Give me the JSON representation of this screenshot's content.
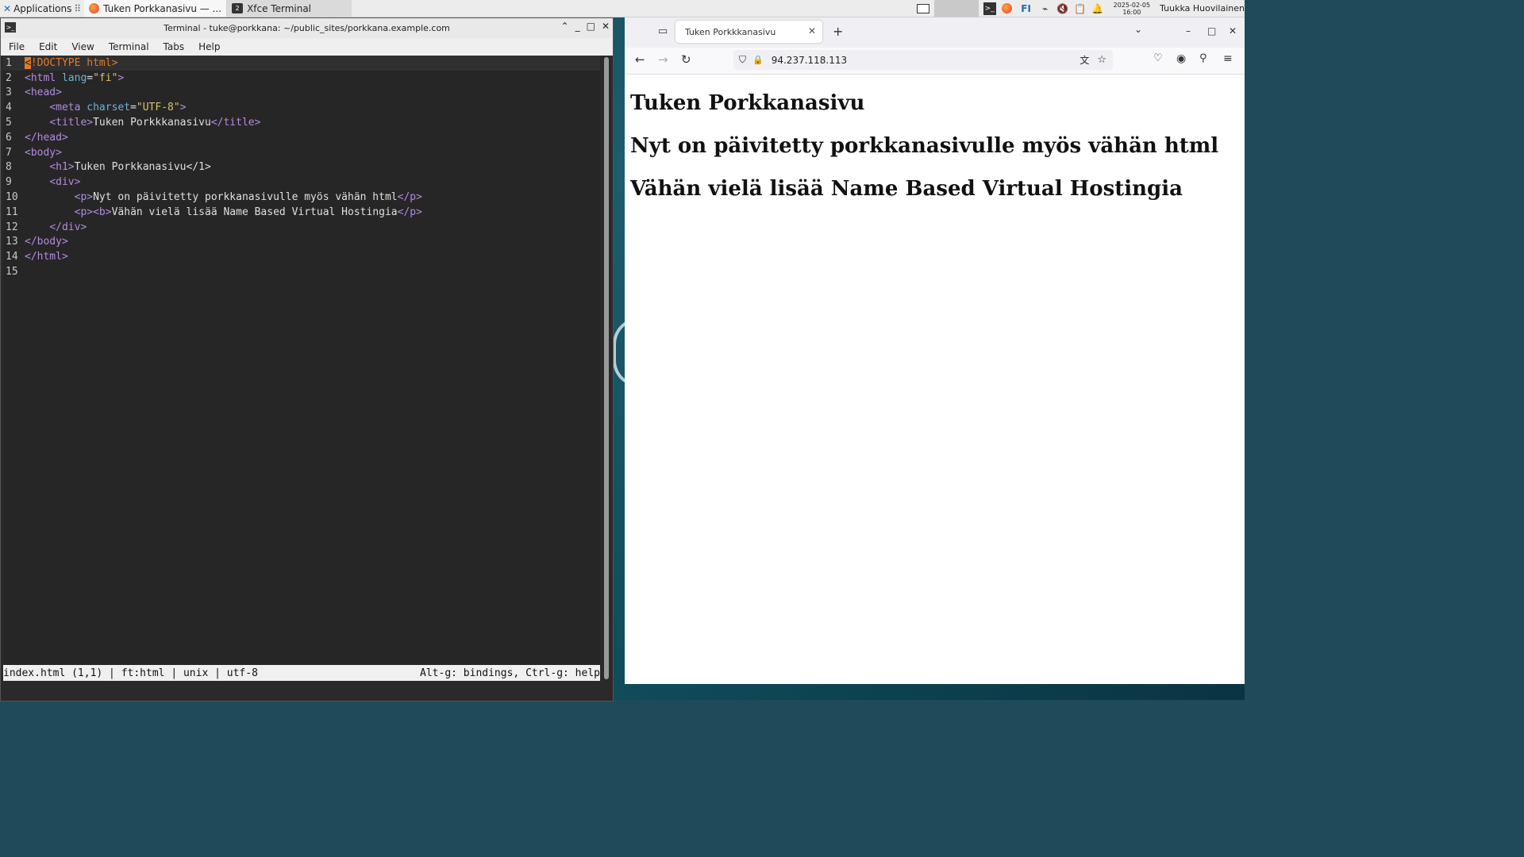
{
  "panel": {
    "apps_label": "Applications",
    "task_browser": "Tuken Porkkanasivu — ...",
    "task_terminal": "Xfce Terminal",
    "task_terminal_badge": "2",
    "keyboard_layout": "FI",
    "date": "2025-02-05",
    "time": "16:00",
    "user": "Tuukka Huovilainen"
  },
  "terminal": {
    "title": "Terminal - tuke@porkkana: ~/public_sites/porkkana.example.com",
    "menu": [
      "File",
      "Edit",
      "View",
      "Terminal",
      "Tabs",
      "Help"
    ],
    "status_left": "index.html (1,1) | ft:html | unix | utf-8",
    "status_right": "Alt-g: bindings, Ctrl-g: help",
    "lines": [
      {
        "n": "1",
        "code": "<!DOCTYPE html>"
      },
      {
        "n": "2",
        "code": "<html lang=\"fi\">"
      },
      {
        "n": "3",
        "code": "<head>"
      },
      {
        "n": "4",
        "code": "    <meta charset=\"UTF-8\">"
      },
      {
        "n": "5",
        "code": "    <title>Tuken Porkkkanasivu</title>"
      },
      {
        "n": "6",
        "code": "</head>"
      },
      {
        "n": "7",
        "code": "<body>"
      },
      {
        "n": "8",
        "code": "    <h1>Tuken Porkkanasivu</1>"
      },
      {
        "n": "9",
        "code": "    <div>"
      },
      {
        "n": "10",
        "code": "        <p>Nyt on päivitetty porkkanasivulle myös vähän html</p>"
      },
      {
        "n": "11",
        "code": "        <p><b>Vähän vielä lisää Name Based Virtual Hostingia</p>"
      },
      {
        "n": "12",
        "code": "    </div>"
      },
      {
        "n": "13",
        "code": "</body>"
      },
      {
        "n": "14",
        "code": "</html>"
      },
      {
        "n": "15",
        "code": ""
      }
    ]
  },
  "browser": {
    "tab_title": "Tuken Porkkkanasivu",
    "url": "94.237.118.113",
    "page": {
      "h1": "Tuken Porkkanasivu",
      "p1": "Nyt on päivitetty porkkanasivulle myös vähän html",
      "p2": "Vähän vielä lisää Name Based Virtual Hostingia"
    }
  }
}
